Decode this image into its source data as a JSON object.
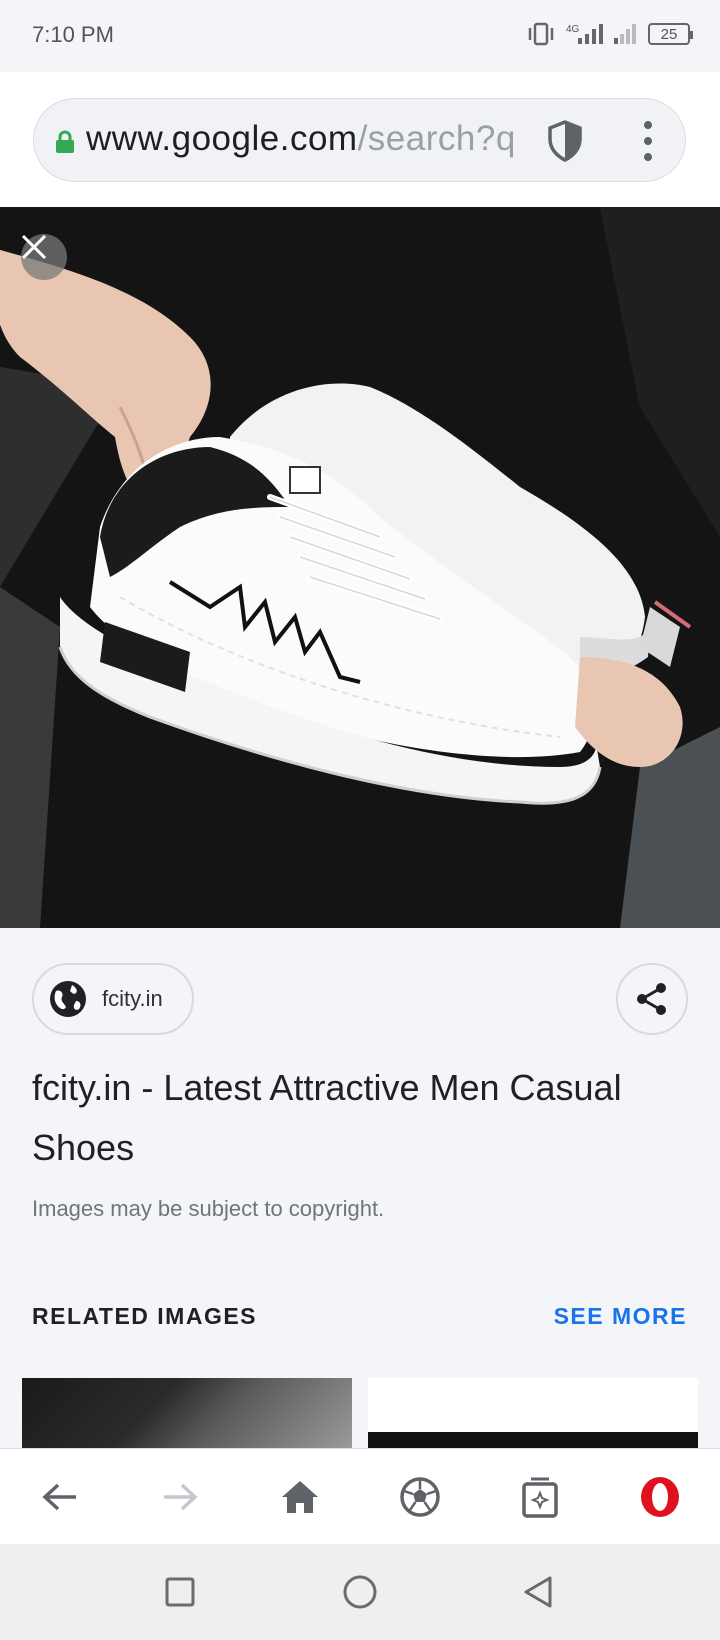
{
  "status_bar": {
    "time": "7:10 PM",
    "network": "4G",
    "battery": "25"
  },
  "url_bar": {
    "host": "www.google.com",
    "path": "/search?q"
  },
  "hero": {
    "description_icon": "close-icon"
  },
  "source": {
    "domain": "fcity.in"
  },
  "result": {
    "title": "fcity.in - Latest Attractive Men Casual Shoes",
    "copyright": "Images may be subject to copyright."
  },
  "related": {
    "heading": "RELATED IMAGES",
    "see_more": "SEE MORE"
  },
  "colors": {
    "accent": "#1a73e8",
    "opera_red": "#e0101e",
    "lock_green": "#34a853"
  }
}
